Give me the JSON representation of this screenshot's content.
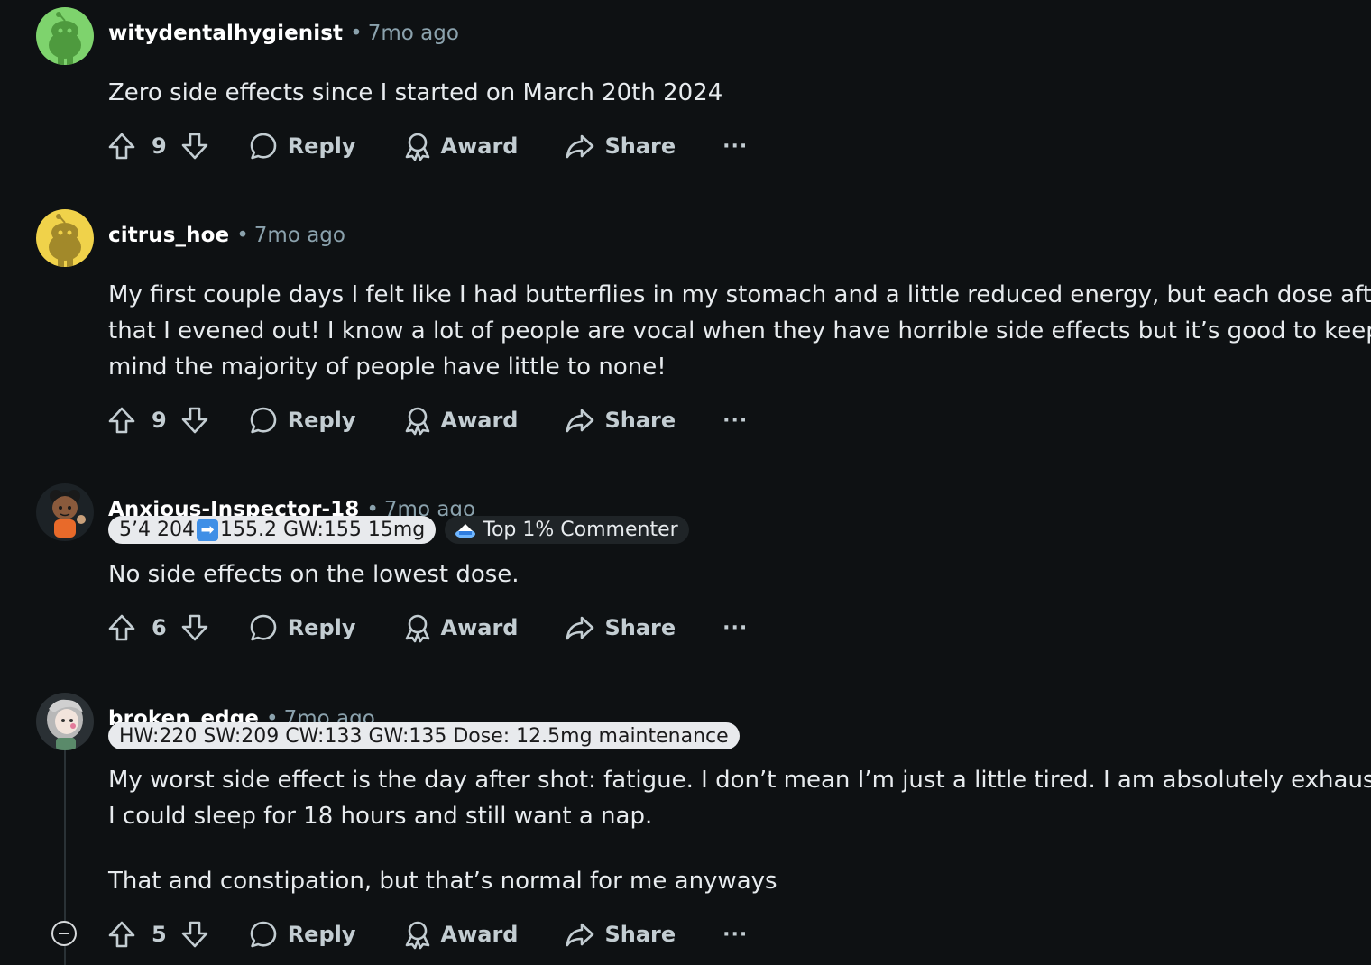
{
  "comments": [
    {
      "username": "witydentalhygienist",
      "separator": "•",
      "time": "7mo ago",
      "avatar_icon": "snoo-avatar-green",
      "avatar_color": "#7ed36d",
      "body": [
        "Zero side effects since I started on March 20th 2024"
      ],
      "votes": "9",
      "reply_label": "Reply",
      "award_label": "Award",
      "share_label": "Share",
      "more_label": "···"
    },
    {
      "username": "citrus_hoe",
      "separator": "•",
      "time": "7mo ago",
      "avatar_icon": "snoo-avatar-yellow",
      "avatar_color": "#f0d24a",
      "body": [
        "My first couple days I felt like I had butterflies in my stomach and a little reduced energy, but each dose after",
        "that I evened out! I know a lot of people are vocal when they have horrible side effects but it’s good to keep in",
        "mind the majority of people have little to none!"
      ],
      "votes": "9",
      "reply_label": "Reply",
      "award_label": "Award",
      "share_label": "Share",
      "more_label": "···"
    },
    {
      "username": "Anxious-Inspector-18",
      "separator": "•",
      "time": "7mo ago",
      "avatar_icon": "custom-avatar-character",
      "flair_before": "5’4 204",
      "flair_emoji": "➡",
      "flair_after": "155.2 GW:155 15mg",
      "badge_icon": "top-commenter-icon",
      "badge": "Top 1% Commenter",
      "body": [
        "No side effects on the lowest dose."
      ],
      "votes": "6",
      "reply_label": "Reply",
      "award_label": "Award",
      "share_label": "Share",
      "more_label": "···"
    },
    {
      "username": "broken_edge",
      "separator": "•",
      "time": "7mo ago",
      "avatar_icon": "custom-avatar-anime",
      "flair": "HW:220 SW:209 CW:133 GW:135 Dose: 12.5mg maintenance",
      "body": [
        "My worst side effect is the day after shot: fatigue. I don’t mean I’m just a little tired. I am absolutely exhausted.",
        "I could sleep for 18 hours and still want a nap."
      ],
      "body2": "That and constipation, but that’s normal for me anyways",
      "votes": "5",
      "reply_label": "Reply",
      "award_label": "Award",
      "share_label": "Share",
      "more_label": "···"
    }
  ]
}
